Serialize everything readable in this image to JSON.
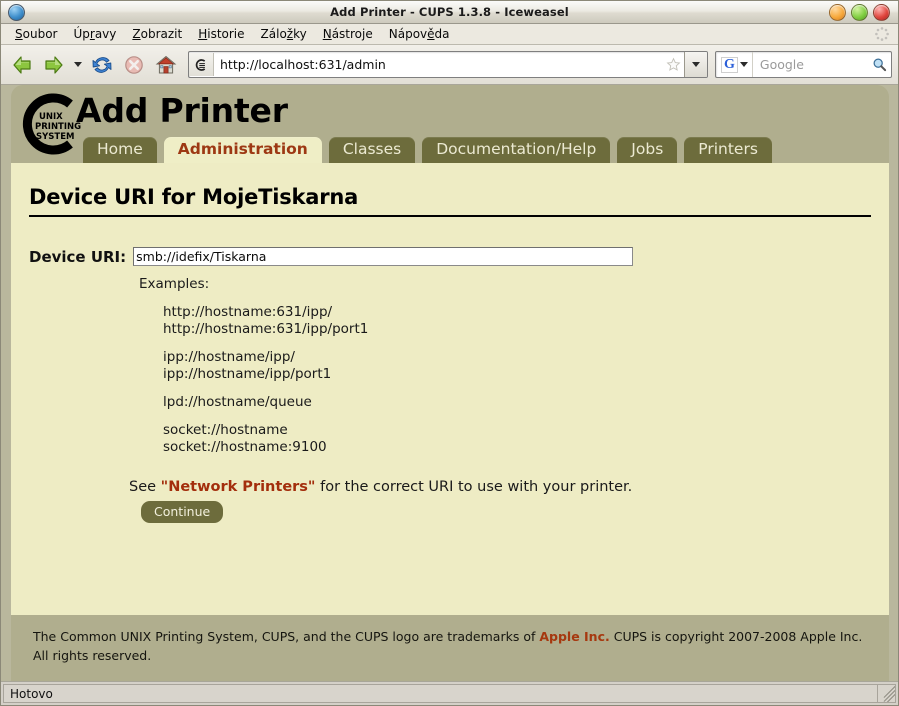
{
  "window": {
    "title": "Add Printer - CUPS 1.3.8 - Iceweasel",
    "buttons": {
      "minimize": "minimize-button",
      "maximize": "maximize-button",
      "close": "close-button"
    }
  },
  "menubar": {
    "items": [
      {
        "label": "Soubor",
        "accel_index": 0
      },
      {
        "label": "Úpravy",
        "accel_index": 2
      },
      {
        "label": "Zobrazit",
        "accel_index": 0
      },
      {
        "label": "Historie",
        "accel_index": 0
      },
      {
        "label": "Záložky",
        "accel_index": 3
      },
      {
        "label": "Nástroje",
        "accel_index": 0
      },
      {
        "label": "Nápověda",
        "accel_index": 4
      }
    ]
  },
  "toolbar": {
    "back": "Zpět",
    "forward": "Vpřed",
    "reload": "Obnovit",
    "stop": "Zastavit",
    "home": "Domů",
    "url": {
      "value": "http://localhost:631/admin",
      "favicon": "cups-favicon"
    },
    "search": {
      "engine": "Google",
      "placeholder": "Google",
      "value": ""
    }
  },
  "cups": {
    "page_title": "Add Printer",
    "logo_lines": [
      "UNIX",
      "PRINTING",
      "SYSTEM"
    ],
    "tabs": [
      {
        "label": "Home",
        "active": false
      },
      {
        "label": "Administration",
        "active": true
      },
      {
        "label": "Classes",
        "active": false
      },
      {
        "label": "Documentation/Help",
        "active": false
      },
      {
        "label": "Jobs",
        "active": false
      },
      {
        "label": "Printers",
        "active": false
      }
    ],
    "heading": "Device URI for MojeTiskarna",
    "form": {
      "uri_label": "Device URI:",
      "uri_value": "smb://idefix/Tiskarna",
      "uri_placeholder": "",
      "examples_label": "Examples:",
      "example_groups": [
        [
          "http://hostname:631/ipp/",
          "http://hostname:631/ipp/port1"
        ],
        [
          "ipp://hostname/ipp/",
          "ipp://hostname/ipp/port1"
        ],
        [
          "lpd://hostname/queue"
        ],
        [
          "socket://hostname",
          "socket://hostname:9100"
        ]
      ],
      "see_prefix": "See ",
      "see_link": "\"Network Printers\"",
      "see_suffix": " for the correct URI to use with your printer.",
      "continue_label": "Continue"
    },
    "footer": {
      "part1": "The Common UNIX Printing System, CUPS, and the CUPS logo are trademarks of ",
      "link": "Apple Inc.",
      "part2": " CUPS is copyright 2007-2008 Apple Inc. All rights reserved."
    }
  },
  "statusbar": {
    "text": "Hotovo"
  },
  "colors": {
    "tab_inactive_bg": "#6d6c3c",
    "tab_active_bg": "#efeec6",
    "tab_active_text": "#9d3813",
    "content_bg": "#eeecc4",
    "page_bg": "#b0ae8e",
    "link": "#a32e0c"
  }
}
